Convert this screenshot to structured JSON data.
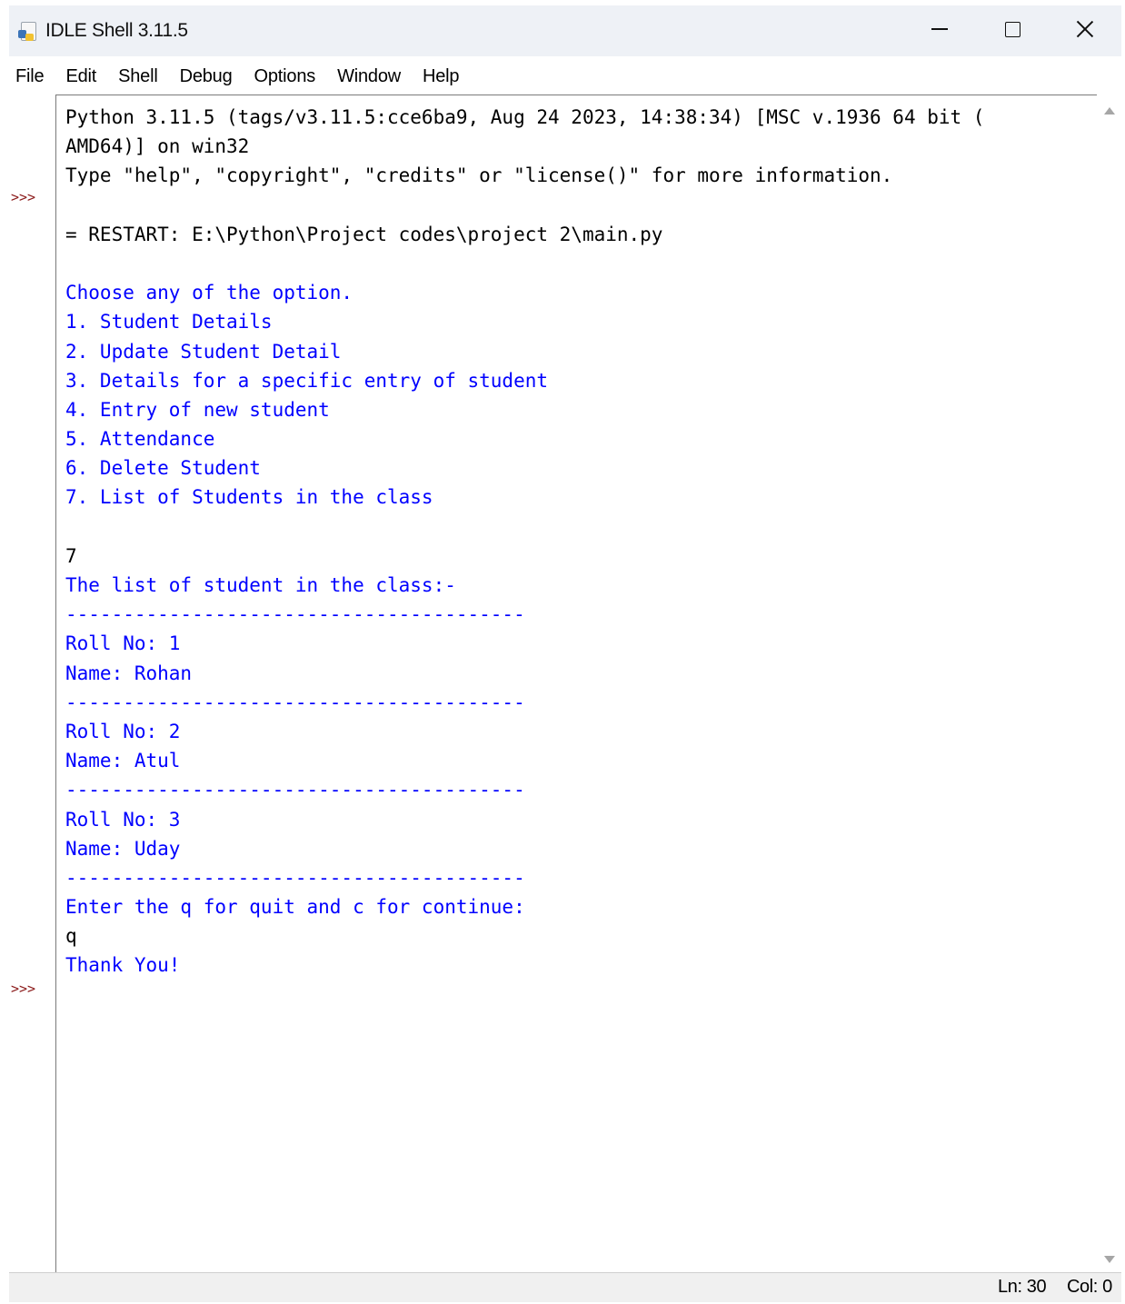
{
  "window": {
    "title": "IDLE Shell 3.11.5"
  },
  "menu": {
    "items": [
      "File",
      "Edit",
      "Shell",
      "Debug",
      "Options",
      "Window",
      "Help"
    ]
  },
  "shell": {
    "prompt": ">>>",
    "lines": [
      {
        "text": "Python 3.11.5 (tags/v3.11.5:cce6ba9, Aug 24 2023, 14:38:34) [MSC v.1936 64 bit (",
        "color": "black"
      },
      {
        "text": "AMD64)] on win32",
        "color": "black"
      },
      {
        "text": "Type \"help\", \"copyright\", \"credits\" or \"license()\" for more information.",
        "color": "black"
      },
      {
        "text": "",
        "color": "black"
      },
      {
        "text": "= RESTART: E:\\Python\\Project codes\\project 2\\main.py",
        "color": "black"
      },
      {
        "text": "",
        "color": "black"
      },
      {
        "text": "Choose any of the option.",
        "color": "blue"
      },
      {
        "text": "1. Student Details",
        "color": "blue"
      },
      {
        "text": "2. Update Student Detail",
        "color": "blue"
      },
      {
        "text": "3. Details for a specific entry of student",
        "color": "blue"
      },
      {
        "text": "4. Entry of new student",
        "color": "blue"
      },
      {
        "text": "5. Attendance",
        "color": "blue"
      },
      {
        "text": "6. Delete Student",
        "color": "blue"
      },
      {
        "text": "7. List of Students in the class",
        "color": "blue"
      },
      {
        "text": "",
        "color": "blue"
      },
      {
        "text": "7",
        "color": "black"
      },
      {
        "text": "The list of student in the class:-",
        "color": "blue"
      },
      {
        "text": "----------------------------------------",
        "color": "blue"
      },
      {
        "text": "Roll No: 1",
        "color": "blue"
      },
      {
        "text": "Name: Rohan",
        "color": "blue"
      },
      {
        "text": "----------------------------------------",
        "color": "blue"
      },
      {
        "text": "Roll No: 2",
        "color": "blue"
      },
      {
        "text": "Name: Atul",
        "color": "blue"
      },
      {
        "text": "----------------------------------------",
        "color": "blue"
      },
      {
        "text": "Roll No: 3",
        "color": "blue"
      },
      {
        "text": "Name: Uday",
        "color": "blue"
      },
      {
        "text": "----------------------------------------",
        "color": "blue"
      },
      {
        "text": "Enter the q for quit and c for continue:",
        "color": "blue"
      },
      {
        "text": "q",
        "color": "black"
      },
      {
        "text": "Thank You!",
        "color": "blue"
      }
    ]
  },
  "status": {
    "ln": "Ln: 30",
    "col": "Col: 0"
  },
  "colors": {
    "stdout": "#0000ff",
    "stdin": "#000000",
    "prompt": "#8b1a1a"
  },
  "icons": {
    "app": "python-idle-icon",
    "minimize": "minimize-icon",
    "maximize": "maximize-icon",
    "close": "close-icon"
  }
}
